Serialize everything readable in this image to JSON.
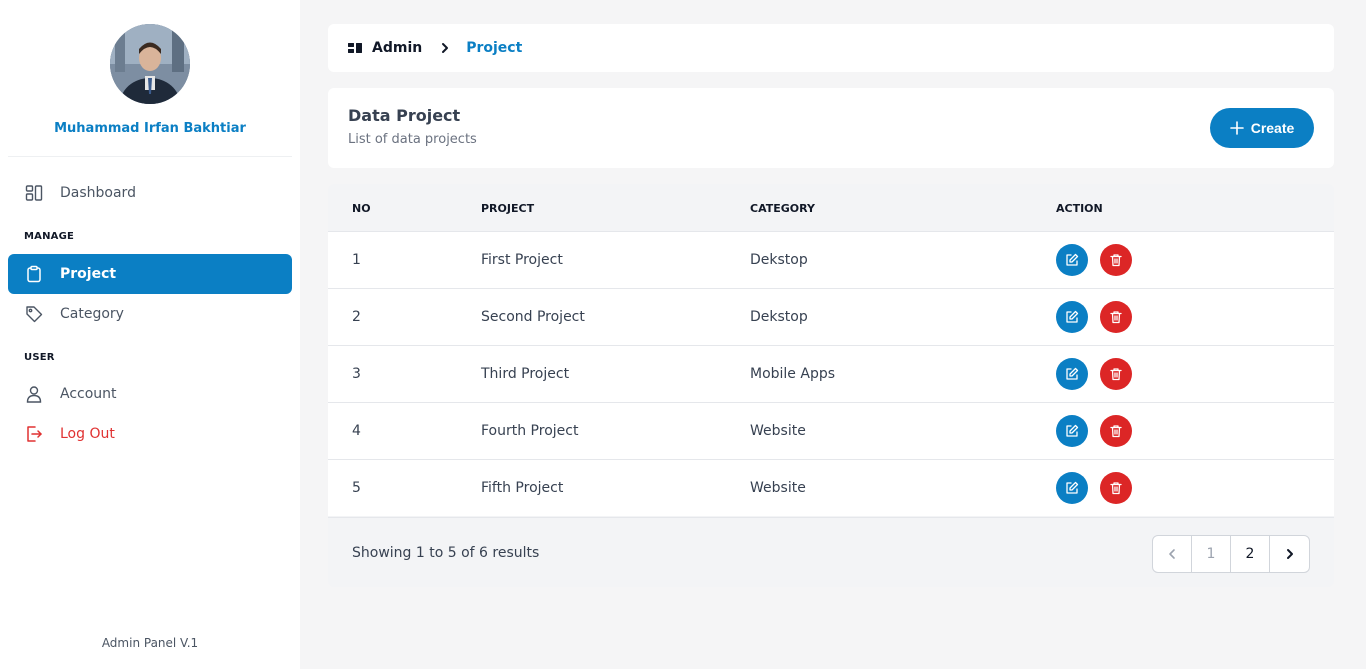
{
  "sidebar": {
    "user_name": "Muhammad Irfan Bakhtiar",
    "items": {
      "dashboard": "Dashboard",
      "project": "Project",
      "category": "Category",
      "account": "Account",
      "logout": "Log Out"
    },
    "sections": {
      "manage": "MANAGE",
      "user": "USER"
    },
    "footer": "Admin Panel V.1"
  },
  "breadcrumb": {
    "home": "Admin",
    "current": "Project"
  },
  "header": {
    "title": "Data Project",
    "subtitle": "List of data projects",
    "create_label": "Create"
  },
  "table": {
    "columns": [
      "NO",
      "PROJECT",
      "CATEGORY",
      "ACTION"
    ],
    "rows": [
      {
        "no": "1",
        "project": "First Project",
        "category": "Dekstop"
      },
      {
        "no": "2",
        "project": "Second Project",
        "category": "Dekstop"
      },
      {
        "no": "3",
        "project": "Third Project",
        "category": "Mobile Apps"
      },
      {
        "no": "4",
        "project": "Fourth Project",
        "category": "Website"
      },
      {
        "no": "5",
        "project": "Fifth Project",
        "category": "Website"
      }
    ]
  },
  "pagination": {
    "summary": "Showing 1 to 5 of 6 results",
    "pages": [
      "1",
      "2"
    ]
  },
  "colors": {
    "primary": "#0b7fc4",
    "danger": "#dc2626"
  }
}
